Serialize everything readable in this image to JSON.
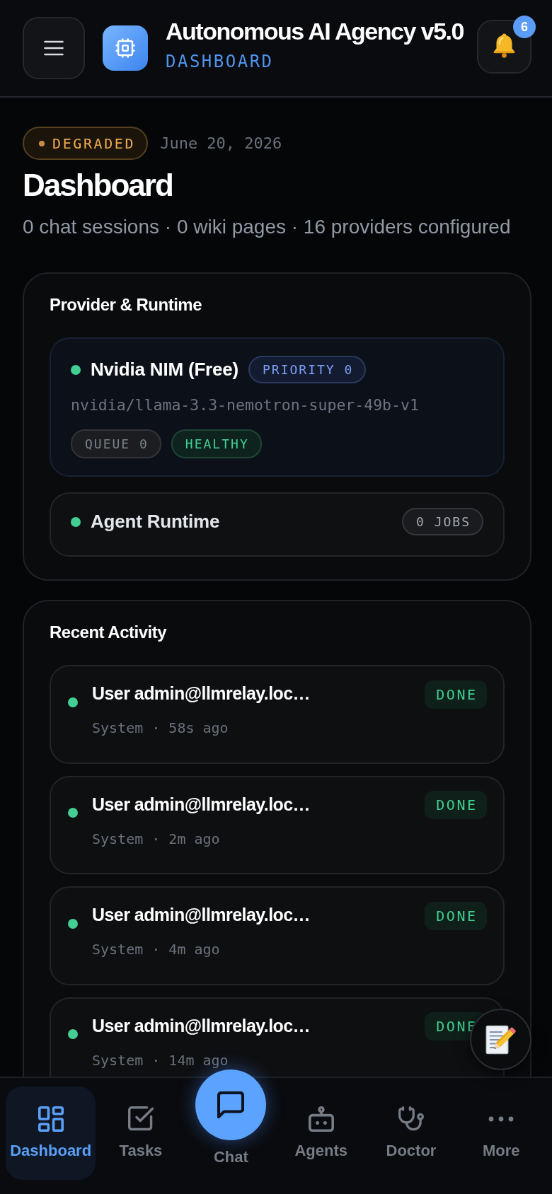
{
  "header": {
    "title": "Autonomous AI Agency v5.0",
    "subtitle": "DASHBOARD",
    "notifications": "6"
  },
  "status": {
    "label": "DEGRADED",
    "date": "June 20, 2026"
  },
  "page": {
    "title": "Dashboard",
    "summary": "0 chat sessions · 0 wiki pages · 16 providers configured"
  },
  "provider_card": {
    "title": "Provider & Runtime",
    "providers": [
      {
        "name": "Nvidia NIM (Free)",
        "online": true,
        "priority": "PRIORITY 0",
        "model": "nvidia/llama-3.3-nemotron-super-49b-v1",
        "tags": [
          {
            "label": "QUEUE 0",
            "kind": "neutral"
          },
          {
            "label": "HEALTHY",
            "kind": "healthy"
          }
        ]
      }
    ],
    "runtime": {
      "name": "Agent Runtime",
      "online": true,
      "jobs": "0 JOBS"
    }
  },
  "activity": {
    "title": "Recent Activity",
    "items": [
      {
        "title": "User admin@llmrelay.loc…",
        "meta": "System · 58s ago",
        "status": "DONE",
        "done": true
      },
      {
        "title": "User admin@llmrelay.loc…",
        "meta": "System · 2m ago",
        "status": "DONE",
        "done": true
      },
      {
        "title": "User admin@llmrelay.loc…",
        "meta": "System · 4m ago",
        "status": "DONE",
        "done": true
      },
      {
        "title": "User admin@llmrelay.loc…",
        "meta": "System · 14m ago",
        "status": "DONE",
        "done": true
      }
    ]
  },
  "nav": [
    {
      "label": "Dashboard",
      "selected": true,
      "kind": "tab"
    },
    {
      "label": "Tasks",
      "selected": false,
      "kind": "tab"
    },
    {
      "label": "Chat",
      "selected": false,
      "kind": "primary"
    },
    {
      "label": "Agents",
      "selected": false,
      "kind": "tab"
    },
    {
      "label": "Doctor",
      "selected": false,
      "kind": "tab"
    },
    {
      "label": "More",
      "selected": false,
      "kind": "tab"
    }
  ]
}
